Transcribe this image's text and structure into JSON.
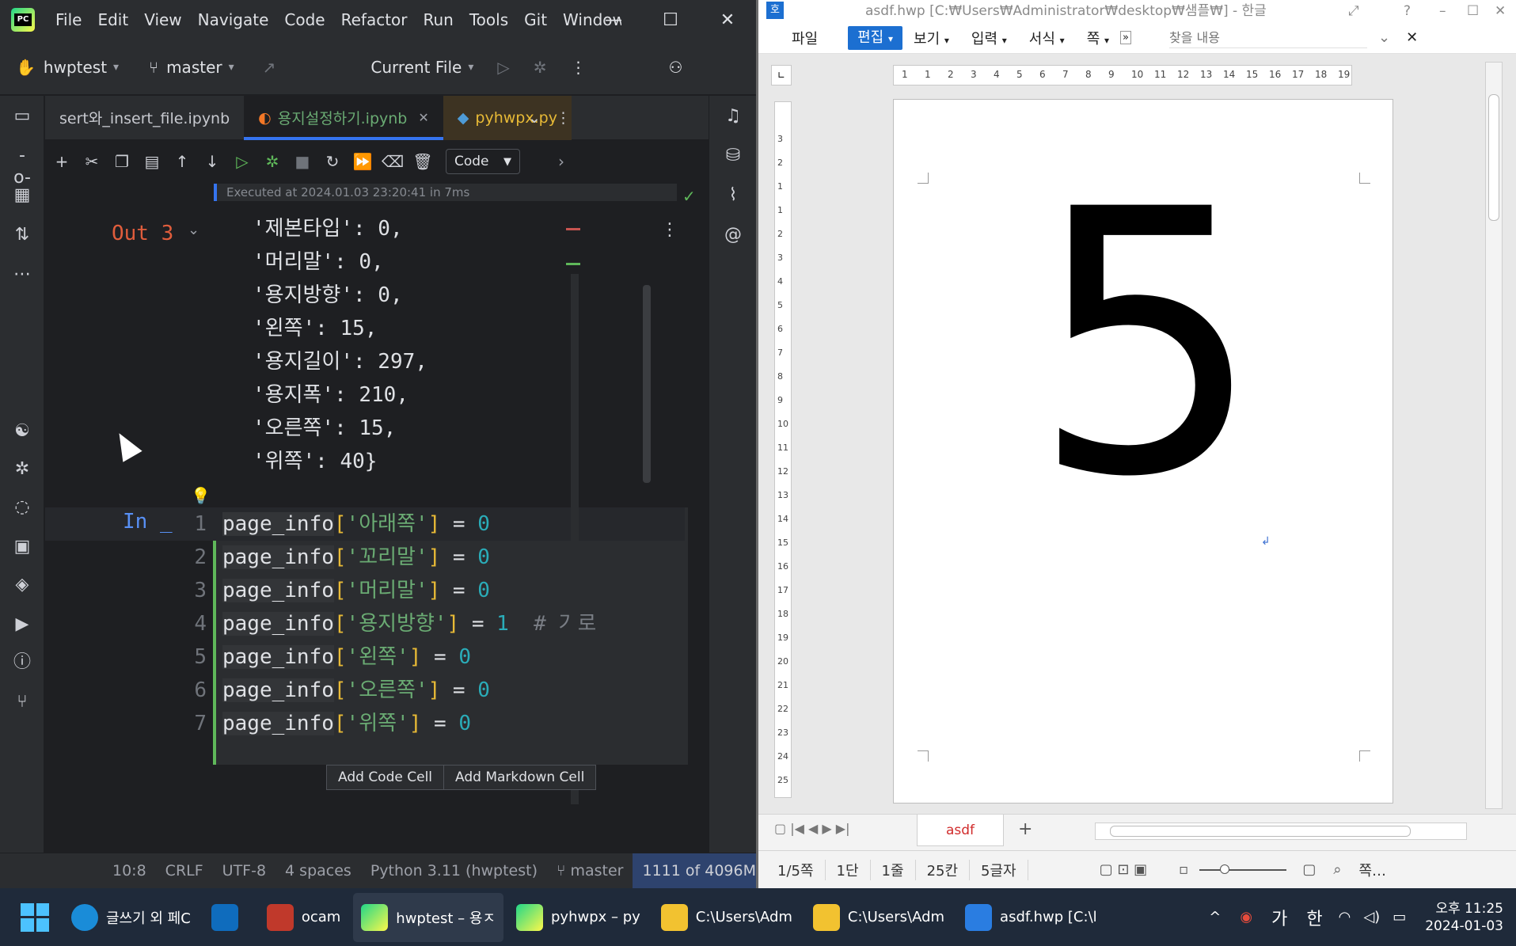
{
  "ide": {
    "menu": [
      "File",
      "Edit",
      "View",
      "Navigate",
      "Code",
      "Refactor",
      "Run",
      "Tools",
      "Git",
      "Window"
    ],
    "project": "hwptest",
    "branch": "master",
    "run_config": "Current File",
    "tabs": [
      {
        "label": "sert와_insert_file.ipynb"
      },
      {
        "label": "용지설정하기.ipynb"
      },
      {
        "label": "pyhwpx.py"
      }
    ],
    "cell_type": "Code",
    "executed_info": "Executed at 2024.01.03 23:20:41 in 7ms",
    "out_label": "Out 3",
    "out_lines": [
      "'제본타입': 0,",
      "'머리말': 0,",
      "'용지방향': 0,",
      "'왼쪽': 15,",
      "'용지길이': 297,",
      "'용지폭': 210,",
      "'오른쪽': 15,",
      "'위쪽': 40}"
    ],
    "in_label": "In _",
    "code_lines": [
      {
        "num": "1",
        "var": "page_info",
        "key": "'아래쪽'",
        "val": "0",
        "comment": ""
      },
      {
        "num": "2",
        "var": "page_info",
        "key": "'꼬리말'",
        "val": "0",
        "comment": ""
      },
      {
        "num": "3",
        "var": "page_info",
        "key": "'머리말'",
        "val": "0",
        "comment": ""
      },
      {
        "num": "4",
        "var": "page_info",
        "key": "'용지방향'",
        "val": "1",
        "comment": "# 가로"
      },
      {
        "num": "5",
        "var": "page_info",
        "key": "'왼쪽'",
        "val": "0",
        "comment": ""
      },
      {
        "num": "6",
        "var": "page_info",
        "key": "'오른쪽'",
        "val": "0",
        "comment": ""
      },
      {
        "num": "7",
        "var": "page_info",
        "key": "'위쪽'",
        "val": "0",
        "comment": ""
      }
    ],
    "add_code_cell": "Add Code Cell",
    "add_markdown_cell": "Add Markdown Cell",
    "status": {
      "position": "10:8",
      "line_sep": "CRLF",
      "encoding": "UTF-8",
      "indent": "4 spaces",
      "interpreter": "Python 3.11 (hwptest)",
      "branch": "master",
      "memory": "1111 of 4096M"
    }
  },
  "hwp": {
    "title": "asdf.hwp [C:₩Users₩Administrator₩desktop₩샘플₩] - 한글",
    "ribbon": [
      "파일",
      "편집",
      "보기",
      "입력",
      "서식",
      "쪽"
    ],
    "search_placeholder": "찾을 내용",
    "ruler_h": [
      "1",
      "1",
      "2",
      "3",
      "4",
      "5",
      "6",
      "7",
      "8",
      "9",
      "10",
      "11",
      "12",
      "13",
      "14",
      "15",
      "16",
      "17",
      "18",
      "19"
    ],
    "ruler_v": [
      "3",
      "2",
      "1",
      "1",
      "2",
      "3",
      "4",
      "5",
      "6",
      "7",
      "8",
      "9",
      "10",
      "11",
      "12",
      "13",
      "14",
      "15",
      "16",
      "17",
      "18",
      "19",
      "20",
      "21",
      "22",
      "23",
      "24",
      "25"
    ],
    "page_content": "5",
    "sheet_tab": "asdf",
    "status": [
      "1/5쪽",
      "1단",
      "1줄",
      "25칸",
      "5글자"
    ],
    "zoom_label": "쪽…"
  },
  "taskbar": {
    "apps": [
      {
        "label": "글쓰기 외 페C",
        "color": "#1a8cd8"
      },
      {
        "label": "",
        "color": "#0f6cbd"
      },
      {
        "label": "ocam",
        "color": "#c0392b"
      },
      {
        "label": "hwptest – 용ㅈ",
        "color": "#21d789"
      },
      {
        "label": "pyhwpx – py",
        "color": "#21d789"
      },
      {
        "label": "C:\\Users\\Adm",
        "color": "#f2c230"
      },
      {
        "label": "C:\\Users\\Adm",
        "color": "#f2c230"
      },
      {
        "label": "asdf.hwp [C:\\l",
        "color": "#2a7de1"
      }
    ],
    "ime1": "가",
    "ime2": "한",
    "time": "오후 11:25",
    "date": "2024-01-03"
  }
}
